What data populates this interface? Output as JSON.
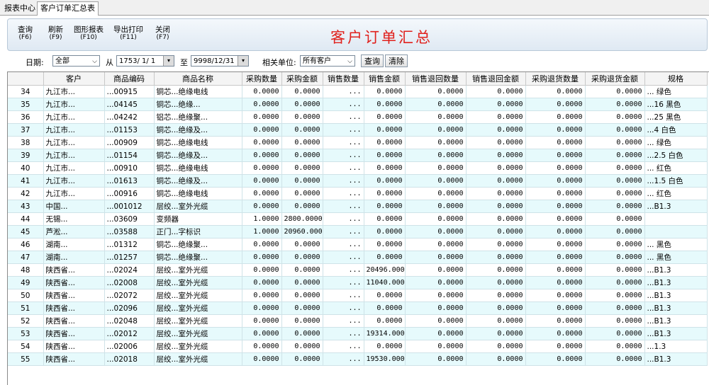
{
  "tabs": [
    "报表中心",
    "客户订单汇总表"
  ],
  "toolbar": {
    "title": "客户订单汇总",
    "buttons": [
      {
        "label": "查询",
        "key": "(F6)"
      },
      {
        "label": "刷新",
        "key": "(F9)"
      },
      {
        "label": "图形报表",
        "key": "(F10)"
      },
      {
        "label": "导出打印",
        "key": "(F11)"
      },
      {
        "label": "关闭",
        "key": "(F7)"
      }
    ]
  },
  "filter": {
    "date_label": "日期:",
    "date_value": "全部",
    "from_label": "从",
    "from_value": "1753/ 1/ 1",
    "to_label": "至",
    "to_value": "9998/12/31",
    "unit_label": "相关单位:",
    "unit_value": "所有客户",
    "query_label": "查询",
    "clear_label": "清除"
  },
  "table": {
    "columns": [
      "客户",
      "商品编码",
      "商品名称",
      "采购数量",
      "采购金额",
      "销售数量",
      "销售金额",
      "销售退回数量",
      "销售退回金额",
      "采购退货数量",
      "采购退货金额",
      "规格"
    ],
    "rows": [
      [
        "34",
        "九江市...",
        "...00915",
        "铜芯...绝缘电线",
        "0.0000",
        "0.0000",
        "...",
        "0.0000",
        "0.0000",
        "0.0000",
        "0.0000",
        "0.0000",
        "... 绿色"
      ],
      [
        "35",
        "九江市...",
        "...04145",
        "铜芯...绝缘...",
        "0.0000",
        "0.0000",
        "...",
        "0.0000",
        "0.0000",
        "0.0000",
        "0.0000",
        "0.0000",
        "...16 黑色"
      ],
      [
        "36",
        "九江市...",
        "...04242",
        "铝芯...绝缘聚...",
        "0.0000",
        "0.0000",
        "...",
        "0.0000",
        "0.0000",
        "0.0000",
        "0.0000",
        "0.0000",
        "...25 黑色"
      ],
      [
        "37",
        "九江市...",
        "...01153",
        "铜芯...绝缘及...",
        "0.0000",
        "0.0000",
        "...",
        "0.0000",
        "0.0000",
        "0.0000",
        "0.0000",
        "0.0000",
        "...4 白色"
      ],
      [
        "38",
        "九江市...",
        "...00909",
        "铜芯...绝缘电线",
        "0.0000",
        "0.0000",
        "...",
        "0.0000",
        "0.0000",
        "0.0000",
        "0.0000",
        "0.0000",
        "... 绿色"
      ],
      [
        "39",
        "九江市...",
        "...01154",
        "铜芯...绝缘及...",
        "0.0000",
        "0.0000",
        "...",
        "0.0000",
        "0.0000",
        "0.0000",
        "0.0000",
        "0.0000",
        "...2.5 白色"
      ],
      [
        "40",
        "九江市...",
        "...00910",
        "铜芯...绝缘电线",
        "0.0000",
        "0.0000",
        "...",
        "0.0000",
        "0.0000",
        "0.0000",
        "0.0000",
        "0.0000",
        "... 红色"
      ],
      [
        "41",
        "九江市...",
        "...01613",
        "铜芯...绝缘及...",
        "0.0000",
        "0.0000",
        "...",
        "0.0000",
        "0.0000",
        "0.0000",
        "0.0000",
        "0.0000",
        "...1.5 白色"
      ],
      [
        "42",
        "九江市...",
        "...00916",
        "铜芯...绝缘电线",
        "0.0000",
        "0.0000",
        "...",
        "0.0000",
        "0.0000",
        "0.0000",
        "0.0000",
        "0.0000",
        "... 红色"
      ],
      [
        "43",
        "中国...",
        "...001012",
        "层绞...室外光缆",
        "0.0000",
        "0.0000",
        "...",
        "0.0000",
        "0.0000",
        "0.0000",
        "0.0000",
        "0.0000",
        "...B1.3"
      ],
      [
        "44",
        "无锡...",
        "...03609",
        "变频器",
        "1.0000",
        "2800.0000",
        "...",
        "0.0000",
        "0.0000",
        "0.0000",
        "0.0000",
        "0.0000",
        ""
      ],
      [
        "45",
        "芦淞...",
        "...03588",
        "正门...字标识",
        "1.0000",
        "20960.0000",
        "...",
        "0.0000",
        "0.0000",
        "0.0000",
        "0.0000",
        "0.0000",
        ""
      ],
      [
        "46",
        "湖南...",
        "...01312",
        "铜芯...绝缘聚...",
        "0.0000",
        "0.0000",
        "...",
        "0.0000",
        "0.0000",
        "0.0000",
        "0.0000",
        "0.0000",
        "... 黑色"
      ],
      [
        "47",
        "湖南...",
        "...01257",
        "铜芯...绝缘聚...",
        "0.0000",
        "0.0000",
        "...",
        "0.0000",
        "0.0000",
        "0.0000",
        "0.0000",
        "0.0000",
        "... 黑色"
      ],
      [
        "48",
        "陕西省...",
        "...02024",
        "层绞...室外光缆",
        "0.0000",
        "0.0000",
        "...",
        "20496.0000",
        "0.0000",
        "0.0000",
        "0.0000",
        "0.0000",
        "...B1.3"
      ],
      [
        "49",
        "陕西省...",
        "...02008",
        "层绞...室外光缆",
        "0.0000",
        "0.0000",
        "...",
        "11040.0000",
        "0.0000",
        "0.0000",
        "0.0000",
        "0.0000",
        "...B1.3"
      ],
      [
        "50",
        "陕西省...",
        "...02072",
        "层绞...室外光缆",
        "0.0000",
        "0.0000",
        "...",
        "0.0000",
        "0.0000",
        "0.0000",
        "0.0000",
        "0.0000",
        "...B1.3"
      ],
      [
        "51",
        "陕西省...",
        "...02096",
        "层绞...室外光缆",
        "0.0000",
        "0.0000",
        "...",
        "0.0000",
        "0.0000",
        "0.0000",
        "0.0000",
        "0.0000",
        "...B1.3"
      ],
      [
        "52",
        "陕西省...",
        "...02048",
        "层绞...室外光缆",
        "0.0000",
        "0.0000",
        "...",
        "0.0000",
        "0.0000",
        "0.0000",
        "0.0000",
        "0.0000",
        "...B1.3"
      ],
      [
        "53",
        "陕西省...",
        "...02012",
        "层绞...室外光缆",
        "0.0000",
        "0.0000",
        "...",
        "19314.0000",
        "0.0000",
        "0.0000",
        "0.0000",
        "0.0000",
        "...B1.3"
      ],
      [
        "54",
        "陕西省...",
        "...02006",
        "层绞...室外光缆",
        "0.0000",
        "0.0000",
        "...",
        "0.0000",
        "0.0000",
        "0.0000",
        "0.0000",
        "0.0000",
        "...1.3"
      ],
      [
        "55",
        "陕西省...",
        "...02018",
        "层绞...室外光缆",
        "0.0000",
        "0.0000",
        "...",
        "19530.0000",
        "0.0000",
        "0.0000",
        "0.0000",
        "0.0000",
        "...B1.3"
      ]
    ]
  },
  "colors": {
    "title": "#e0201c",
    "row_alt": "#e6fafc",
    "grid_line": "#cfe3e8"
  }
}
